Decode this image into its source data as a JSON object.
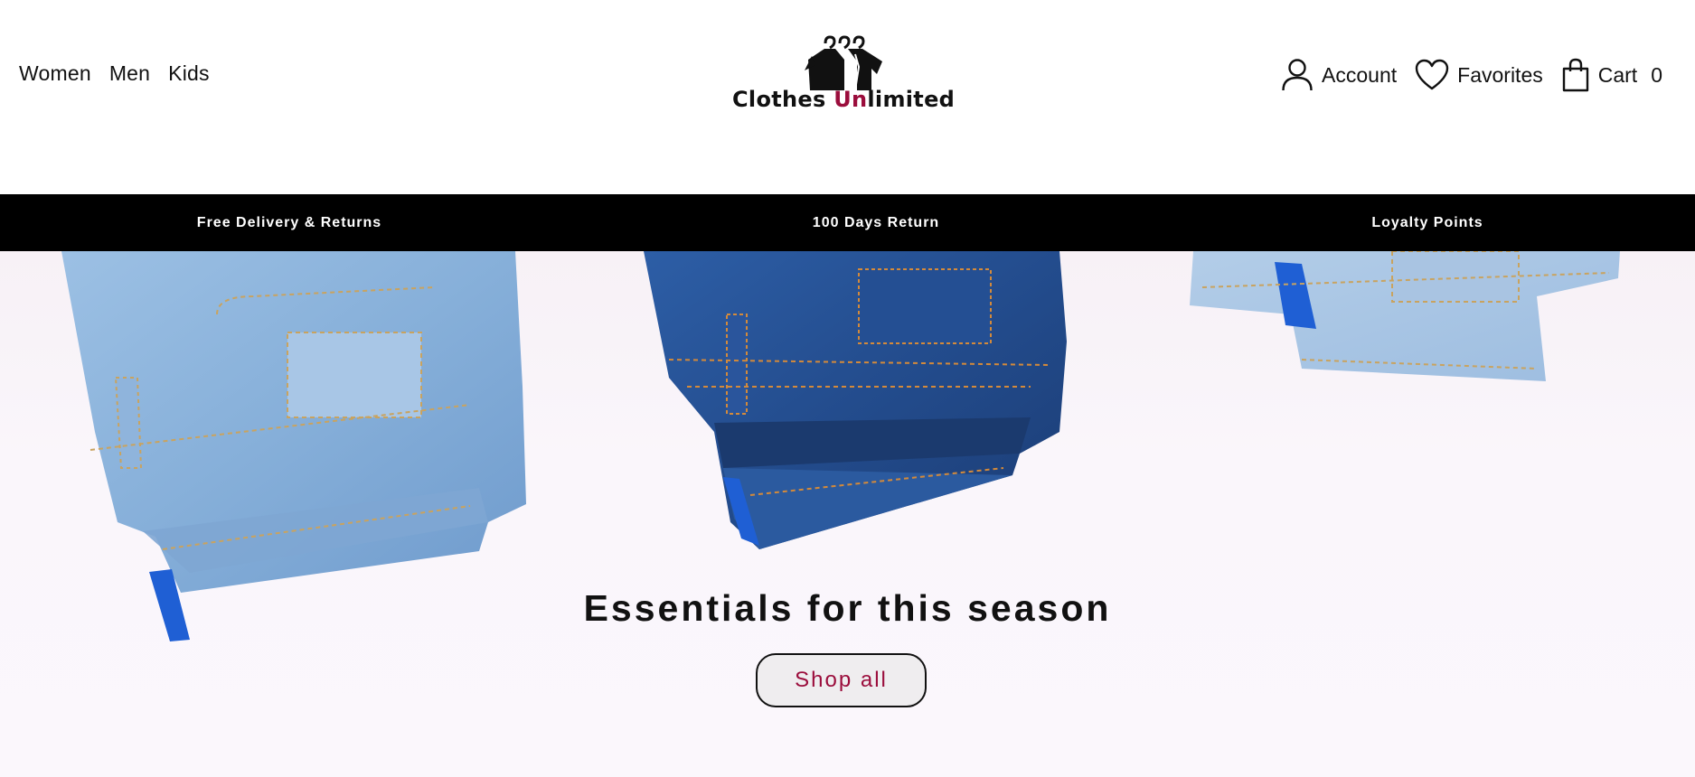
{
  "nav": {
    "categories": [
      "Women",
      "Men",
      "Kids"
    ]
  },
  "brand": {
    "name_part1": "Clothes ",
    "name_accent": "Un",
    "name_part2": "limited",
    "accent_color": "#9b0d3c"
  },
  "actions": {
    "account_label": "Account",
    "favorites_label": "Favorites",
    "cart_label": "Cart",
    "cart_count": "0"
  },
  "promo": {
    "items": [
      "Free Delivery & Returns",
      "100 Days Return",
      "Loyalty Points"
    ]
  },
  "hero": {
    "title": "Essentials for this season",
    "cta_label": "Shop all"
  },
  "icons": {
    "logo": "hanger-clothes-icon",
    "account": "user-icon",
    "favorites": "heart-icon",
    "cart": "shopping-bag-icon"
  }
}
